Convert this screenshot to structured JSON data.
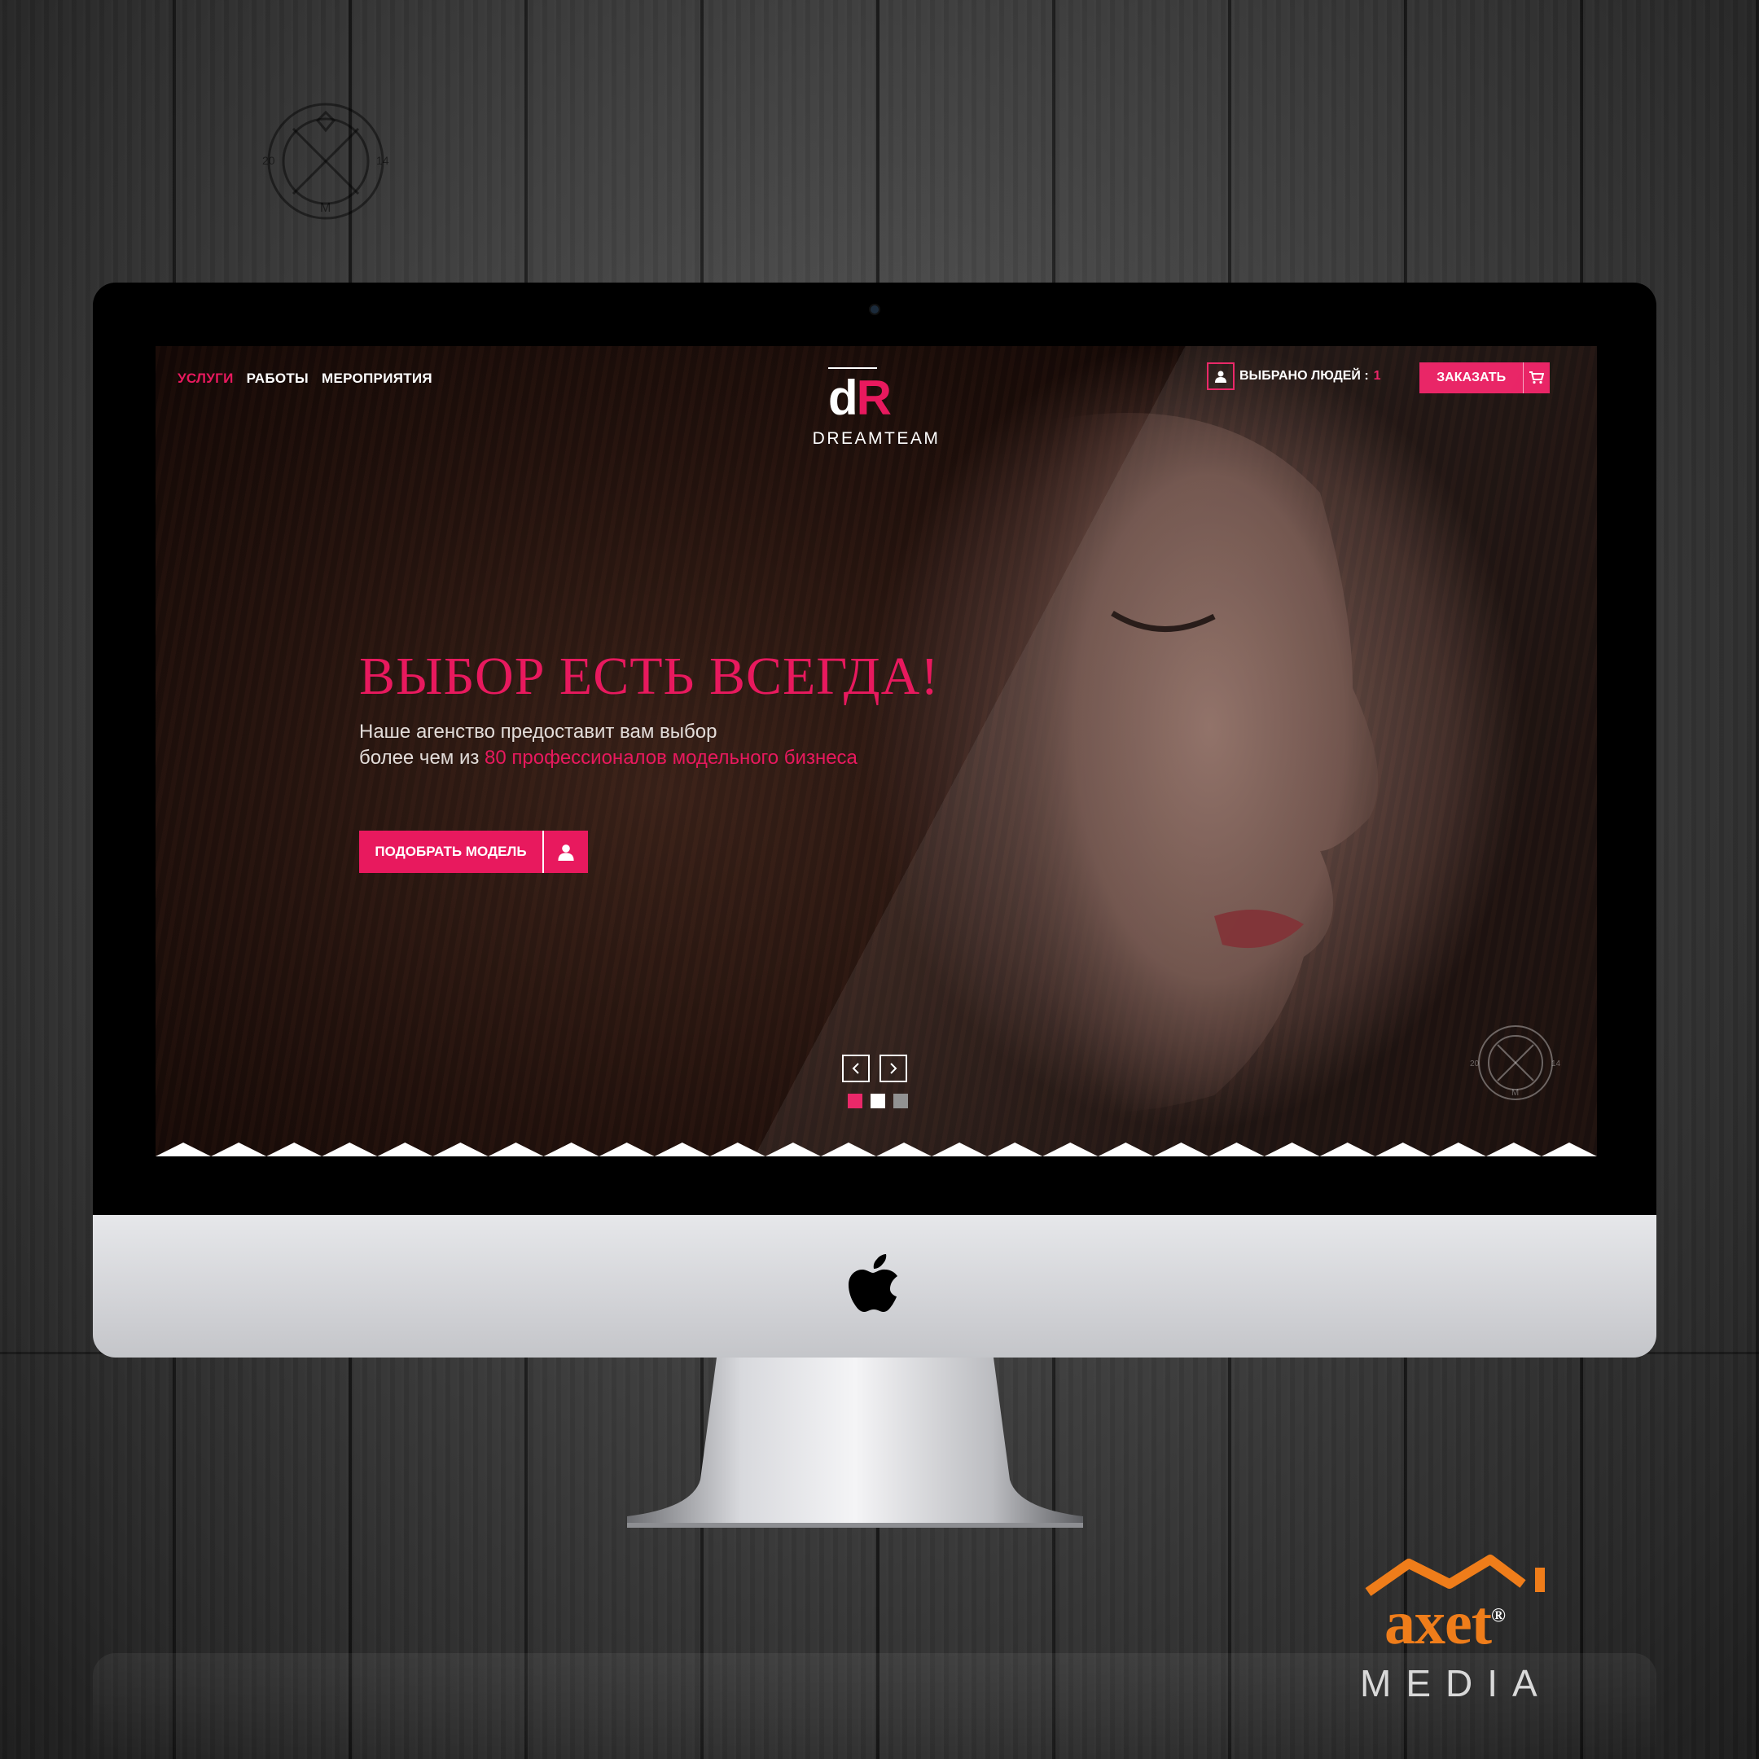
{
  "nav": {
    "items": [
      {
        "label": "УСЛУГИ",
        "active": true
      },
      {
        "label": "РАБОТЫ",
        "active": false
      },
      {
        "label": "МЕРОПРИЯТИЯ",
        "active": false
      }
    ]
  },
  "logo": {
    "letter_d": "d",
    "letter_r": "R",
    "name": "DREAMTEAM"
  },
  "header": {
    "selected_label": "ВЫБРАНО ЛЮДЕЙ :",
    "selected_count": "1",
    "order_button": "ЗАКАЗАТЬ"
  },
  "hero": {
    "title": "ВЫБОР ЕСТЬ ВСЕГДА!",
    "subtitle_line1": "Наше агенство предоставит вам выбор",
    "subtitle_line2_prefix": "более чем из ",
    "subtitle_line2_highlight": "80 профессионалов модельного бизнеса",
    "cta_button": "ПОДОБРАТЬ МОДЕЛЬ"
  },
  "slider": {
    "dots": [
      {
        "color": "#e8195e",
        "active": true
      },
      {
        "color": "#ffffff",
        "active": false
      },
      {
        "color": "#8a8a8a",
        "active": false
      }
    ]
  },
  "icons": {
    "cart": "cart-icon",
    "user": "user-icon",
    "prev": "chevron-left-icon",
    "next": "chevron-right-icon",
    "apple": "apple-icon"
  },
  "emblem": {
    "left_digits": "20",
    "right_digits": "14",
    "letter": "M"
  },
  "watermark": {
    "brand": "axet",
    "registered": "®",
    "media": "MEDIA"
  },
  "colors": {
    "accent": "#e8195e",
    "watermark_orange": "#ef7d1a"
  }
}
